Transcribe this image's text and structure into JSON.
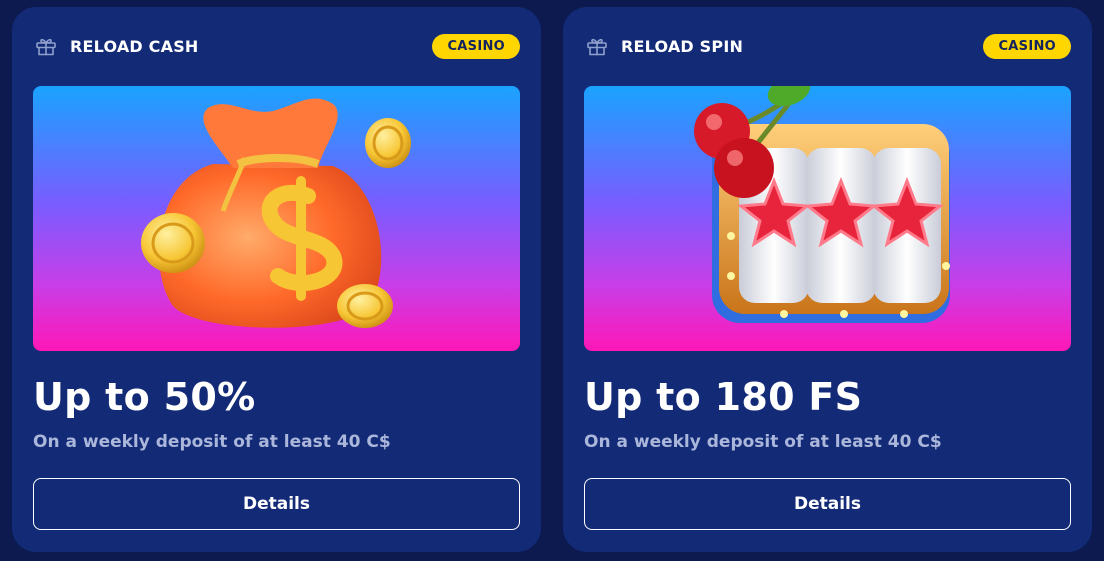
{
  "cards": [
    {
      "title": "RELOAD CASH",
      "badge": "CASINO",
      "icon": "gift-icon",
      "image": "money-bag-with-coins",
      "amount": "Up to 50%",
      "condition": "On a weekly deposit of at least 40 C$",
      "button_label": "Details"
    },
    {
      "title": "RELOAD SPIN",
      "badge": "CASINO",
      "icon": "gift-icon",
      "image": "slot-machine-with-cherries",
      "amount": "Up to 180 FS",
      "condition": "On a weekly deposit of at least 40 C$",
      "button_label": "Details"
    }
  ],
  "colors": {
    "page_bg": "#0c1a4f",
    "card_bg": "#132a77",
    "badge_bg": "#ffd600",
    "badge_text": "#13245f",
    "text_primary": "#ffffff",
    "text_muted": "#aab6da"
  }
}
